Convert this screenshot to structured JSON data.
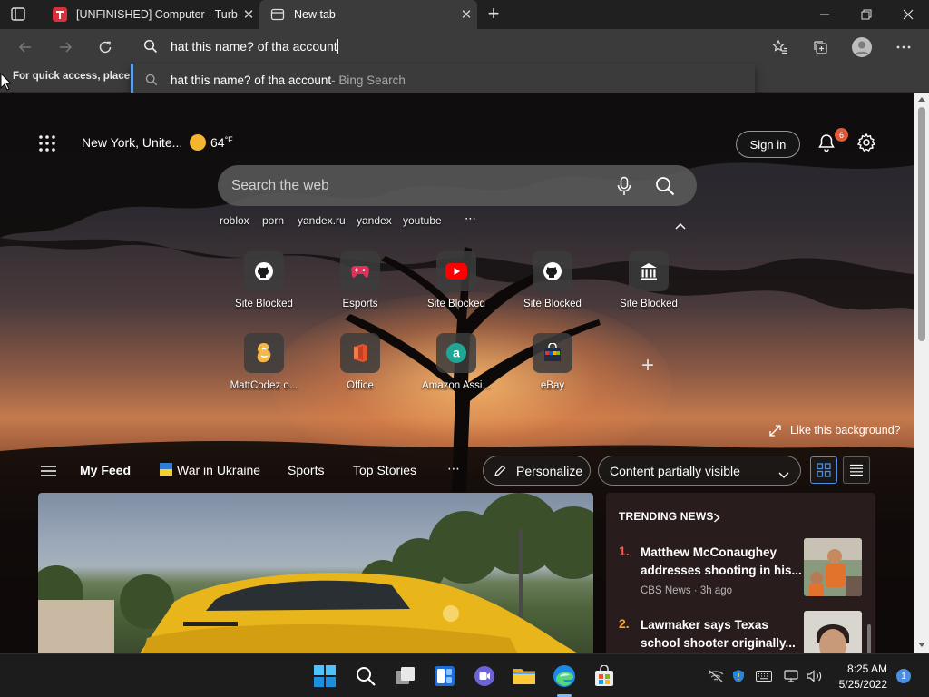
{
  "tabs": [
    {
      "title": "[UNFINISHED] Computer - TurboWarp",
      "active": false
    },
    {
      "title": "New tab",
      "active": true
    }
  ],
  "address_bar": {
    "value": "hat this name? of tha account"
  },
  "suggestion": {
    "query": "hat this name? of tha account",
    "source": " - Bing Search"
  },
  "favorites_hint": "For quick access, place y",
  "weather": {
    "location": "New York, Unite...",
    "temp": "64",
    "unit": "°F"
  },
  "header": {
    "sign_in": "Sign in",
    "notification_count": "6"
  },
  "search": {
    "placeholder": "Search the web"
  },
  "quick_links": [
    "roblox",
    "porn",
    "yandex.ru",
    "yandex",
    "youtube"
  ],
  "quick_links_more": "⋯",
  "tiles": [
    {
      "label": "Site Blocked",
      "icon": "github-icon"
    },
    {
      "label": "Esports",
      "icon": "gamepad-icon"
    },
    {
      "label": "Site Blocked",
      "icon": "youtube-icon"
    },
    {
      "label": "Site Blocked",
      "icon": "github-icon"
    },
    {
      "label": "Site Blocked",
      "icon": "bank-icon"
    },
    {
      "label": "MattCodez o...",
      "icon": "scratch-icon"
    },
    {
      "label": "Office",
      "icon": "office-icon"
    },
    {
      "label": "Amazon Assi...",
      "icon": "amazon-icon"
    },
    {
      "label": "eBay",
      "icon": "shopping-bag-icon"
    }
  ],
  "add_tile": "+",
  "like_background": "Like this background?",
  "feed_nav": {
    "my_feed": "My Feed",
    "items": [
      "War in Ukraine",
      "Sports",
      "Top Stories"
    ],
    "more": "⋯",
    "personalize": "Personalize",
    "content_visibility": "Content partially visible"
  },
  "trending": {
    "title": "TRENDING NEWS",
    "items": [
      {
        "rank": "1.",
        "headline": "Matthew McConaughey addresses shooting in his...",
        "source": "CBS News · 3h ago",
        "rank_color": "#ff5a52"
      },
      {
        "rank": "2.",
        "headline": "Lawmaker says Texas school shooter originally...",
        "source": "",
        "rank_color": "#ffa52a"
      }
    ]
  },
  "taskbar": {
    "apps": [
      "windows-start-icon",
      "search-icon",
      "task-view-icon",
      "widgets-icon",
      "teams-chat-icon",
      "file-explorer-icon",
      "edge-icon",
      "store-icon"
    ],
    "time": "8:25 AM",
    "date": "5/25/2022",
    "notifications": "1"
  },
  "colors": {
    "accent": "#4c8ee0",
    "badge": "#e05a38",
    "weather_sun": "#f4b630"
  }
}
